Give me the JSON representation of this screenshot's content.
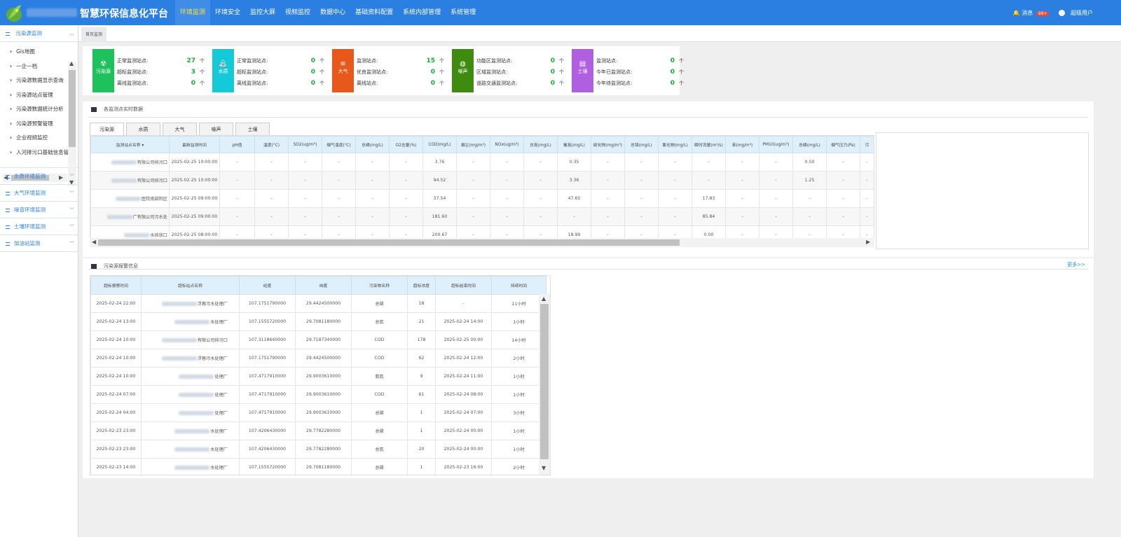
{
  "header": {
    "brand": "智慧环保信息化平台",
    "nav": [
      "环境监测",
      "环境安全",
      "监控大屏",
      "视频监控",
      "数据中心",
      "基础资料配置",
      "系统内部管理",
      "系统管理"
    ],
    "message_label": "消息",
    "message_badge": "99+",
    "user_label": "超级用户"
  },
  "sidebar": {
    "group1_title": "污染源监测",
    "sub_items": [
      "Gis地图",
      "一企一档",
      "污染源数据显示查询",
      "污染源站点管理",
      "污染源数据统计分析",
      "污染源预警管理",
      "企业视频监控",
      "入河排污口基础信息管"
    ],
    "groups": [
      "水质环境监测",
      "大气环境监测",
      "噪音环境监测",
      "土壤环境监测",
      "加油站监测"
    ]
  },
  "page_tab": "首页监测",
  "summary": [
    {
      "name": "污染源",
      "color": "#1fc15d",
      "rows": [
        {
          "label": "正常监测站点:",
          "value": "27",
          "unit": "个"
        },
        {
          "label": "超标监测站点:",
          "value": "3",
          "unit": "个"
        },
        {
          "label": "离线监测站点:",
          "value": "0",
          "unit": "个"
        }
      ]
    },
    {
      "name": "水质",
      "color": "#14cad8",
      "rows": [
        {
          "label": "正常监测站点:",
          "value": "0",
          "unit": "个"
        },
        {
          "label": "超标监测站点:",
          "value": "0",
          "unit": "个"
        },
        {
          "label": "离线监测站点:",
          "value": "0",
          "unit": "个"
        }
      ]
    },
    {
      "name": "大气",
      "color": "#e9581b",
      "rows": [
        {
          "label": "监测站点:",
          "value": "15",
          "unit": "个"
        },
        {
          "label": "优良监测站点:",
          "value": "0",
          "unit": "个"
        },
        {
          "label": "离线站点:",
          "value": "0",
          "unit": "个"
        }
      ]
    },
    {
      "name": "噪声",
      "color": "#3f8b0f",
      "rows": [
        {
          "label": "功能区监测站点:",
          "value": "0",
          "unit": "个"
        },
        {
          "label": "区域监测站点:",
          "value": "0",
          "unit": "个"
        },
        {
          "label": "道路交通监测站点:",
          "value": "0",
          "unit": "个"
        }
      ]
    },
    {
      "name": "土壤",
      "color": "#b05fe0",
      "rows": [
        {
          "label": "监测站点:",
          "value": "0",
          "unit": "个"
        },
        {
          "label": "今年已监测站点:",
          "value": "0",
          "unit": "个"
        },
        {
          "label": "今年待监测站点:",
          "value": "0",
          "unit": "个"
        }
      ]
    }
  ],
  "realtime": {
    "title": "各监测点实时数据",
    "tabs": [
      "污染源",
      "水质",
      "大气",
      "噪声",
      "土壤"
    ],
    "headers": [
      "监测站点名称 ▾",
      "最新监测时间",
      "pH值",
      "温度(°C)",
      "SO2(ug/m³)",
      "烟气温度(℃)",
      "总磷(mg/L)",
      "O2含量(%)",
      "COD(mg/L)",
      "烟尘(mg/m³)",
      "NOx(ug/m³)",
      "总氮(mg/L)",
      "氨氮(mg/L)",
      "硫化物(mg/m³)",
      "总铬(mg/L)",
      "氯化物(mg/L)",
      "瞬时流量(m³/s)",
      "苯(mg/m³)",
      "PM10(ug/m³)",
      "总磷(mg/L)",
      "烟气压力(Pa)",
      "污"
    ],
    "rows": [
      {
        "name": "有限公司排污口",
        "time": "2025-02-25 10:00:00",
        "vals": [
          "-",
          "-",
          "-",
          "-",
          "-",
          "-",
          "3.76",
          "-",
          "-",
          "-",
          "0.35",
          "-",
          "-",
          "-",
          "-",
          "-",
          "-",
          "0.50",
          "-",
          "-"
        ]
      },
      {
        "name": "有限公司排污口",
        "time": "2025-02-25 10:00:00",
        "vals": [
          "-",
          "-",
          "-",
          "-",
          "-",
          "-",
          "94.52",
          "-",
          "-",
          "-",
          "3.36",
          "-",
          "-",
          "-",
          "-",
          "-",
          "-",
          "1.25",
          "-",
          "-"
        ]
      },
      {
        "name": "医院南部院区",
        "time": "2025-02-25 09:00:00",
        "vals": [
          "-",
          "-",
          "-",
          "-",
          "-",
          "-",
          "37.54",
          "-",
          "-",
          "-",
          "47.65",
          "-",
          "-",
          "-",
          "17.83",
          "-",
          "-",
          "-",
          "-",
          "-"
        ]
      },
      {
        "name": "广有限公司污水处",
        "time": "2025-02-25 09:00:00",
        "vals": [
          "-",
          "-",
          "-",
          "-",
          "-",
          "-",
          "181.60",
          "-",
          "-",
          "-",
          "-",
          "-",
          "-",
          "-",
          "85.84",
          "-",
          "-",
          "-",
          "-",
          "-"
        ]
      },
      {
        "name": "水排放口",
        "time": "2025-02-25 08:00:00",
        "vals": [
          "-",
          "-",
          "-",
          "-",
          "-",
          "-",
          "200.67",
          "-",
          "-",
          "-",
          "18.99",
          "-",
          "-",
          "-",
          "0.00",
          "-",
          "-",
          "-",
          "-",
          "-"
        ]
      }
    ]
  },
  "alerts": {
    "title": "污染源报警信息",
    "more": "更多>>",
    "headers": [
      "超标报警时间",
      "超标站点名称",
      "经度",
      "纬度",
      "污染物名称",
      "超标浓度",
      "超标结束时间",
      "持续时间"
    ],
    "rows": [
      [
        "2025-02-24 22:00",
        "浮蓉污水处理厂",
        "107.1751790000",
        "29.4424500000",
        "总磷",
        "18",
        "-",
        "11小时"
      ],
      [
        "2025-02-24 13:00",
        "水处理厂",
        "107.1555720000",
        "29.7081180000",
        "总氮",
        "21",
        "2025-02-24 14:00",
        "1小时"
      ],
      [
        "2025-02-24 10:00",
        "有限公司排污口",
        "107.3118640000",
        "29.7187340000",
        "COD",
        "178",
        "2025-02-25 00:00",
        "14小时"
      ],
      [
        "2025-02-24 10:00",
        "浮蓉污水处理厂",
        "107.1751790000",
        "29.4424500000",
        "COD",
        "62",
        "2025-02-24 12:00",
        "2小时"
      ],
      [
        "2025-02-24 10:00",
        "处理厂",
        "107.4717910000",
        "29.9003610000",
        "氨氮",
        "9",
        "2025-02-24 11:00",
        "1小时"
      ],
      [
        "2025-02-24 07:00",
        "处理厂",
        "107.4717910000",
        "29.9003610000",
        "COD",
        "61",
        "2025-02-24 08:00",
        "1小时"
      ],
      [
        "2025-02-24 04:00",
        "处理厂",
        "107.4717910000",
        "29.9003610000",
        "总磷",
        "1",
        "2025-02-24 07:00",
        "3小时"
      ],
      [
        "2025-02-23 23:00",
        "水处理厂",
        "107.4206430000",
        "29.7782280000",
        "总磷",
        "1",
        "2025-02-24 00:00",
        "1小时"
      ],
      [
        "2025-02-23 23:00",
        "水处理厂",
        "107.4206430000",
        "29.7782280000",
        "总氮",
        "20",
        "2025-02-24 00:00",
        "1小时"
      ],
      [
        "2025-02-23 14:00",
        "水处理厂",
        "107.1555720000",
        "29.7081180000",
        "总磷",
        "1",
        "2025-02-23 16:00",
        "2小时"
      ]
    ]
  }
}
